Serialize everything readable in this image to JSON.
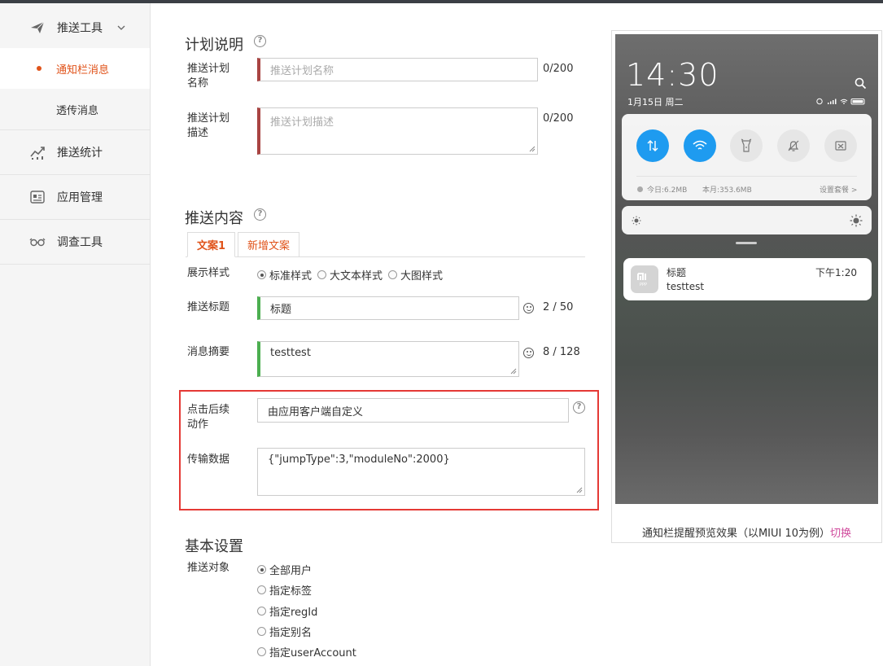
{
  "sidebar": {
    "items": [
      {
        "label": "推送工具",
        "icon": "paper-plane-icon"
      },
      {
        "label": "通知栏消息"
      },
      {
        "label": "透传消息"
      },
      {
        "label": "推送统计",
        "icon": "stats-icon"
      },
      {
        "label": "应用管理",
        "icon": "app-card-icon"
      },
      {
        "label": "调查工具",
        "icon": "glasses-icon"
      }
    ]
  },
  "plan": {
    "title": "计划说明",
    "name_label": "推送计划名称",
    "name_placeholder": "推送计划名称",
    "name_counter": "0/200",
    "desc_label": "推送计划描述",
    "desc_placeholder": "推送计划描述",
    "desc_counter": "0/200"
  },
  "content": {
    "title": "推送内容",
    "tabs": [
      "文案1",
      "新增文案"
    ],
    "style_label": "展示样式",
    "styles": [
      "标准样式",
      "大文本样式",
      "大图样式"
    ],
    "style_selected": "标准样式",
    "push_title_label": "推送标题",
    "push_title_value": "标题",
    "push_title_counter": "2 / 50",
    "summary_label": "消息摘要",
    "summary_value": "testtest",
    "summary_counter": "8 / 128",
    "action_label": "点击后续动作",
    "action_value": "由应用客户端自定义",
    "data_label": "传输数据",
    "data_value": "{\"jumpType\":3,\"moduleNo\":2000}"
  },
  "basic": {
    "title": "基本设置",
    "target_label": "推送对象",
    "targets": [
      "全部用户",
      "指定标签",
      "指定regId",
      "指定别名",
      "指定userAccount"
    ],
    "target_selected": "全部用户"
  },
  "preview": {
    "time": "14:30",
    "date": "1月15日 周二",
    "today_usage": "今日:6.2MB",
    "month_usage": "本月:353.6MB",
    "plan_link": "设置套餐 >",
    "notif_title": "标题",
    "notif_body": "testtest",
    "notif_time": "下午1:20",
    "caption": "通知栏提醒预览效果（以MIUI 10为例）",
    "switch_link": "切换"
  },
  "colors": {
    "accent": "#e0531a",
    "highlight_box": "#e53935",
    "toggle_on": "#1e9bf0"
  }
}
